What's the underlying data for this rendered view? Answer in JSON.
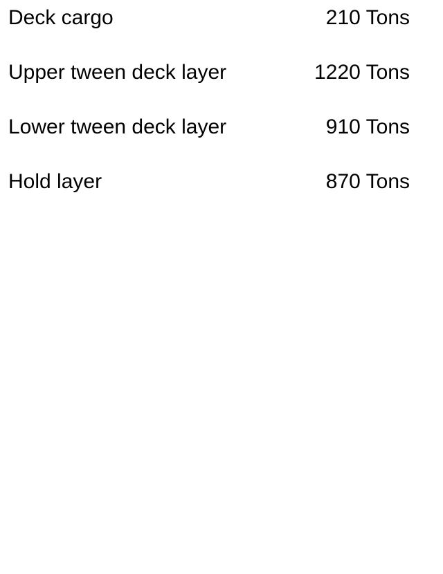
{
  "cargo_distribution": {
    "rows": [
      {
        "label": "Deck cargo",
        "value": "210 Tons"
      },
      {
        "label": "Upper tween deck layer",
        "value": "1220 Tons"
      },
      {
        "label": "Lower tween deck layer",
        "value": "910 Tons"
      },
      {
        "label": "Hold layer",
        "value": "870 Tons"
      }
    ]
  }
}
